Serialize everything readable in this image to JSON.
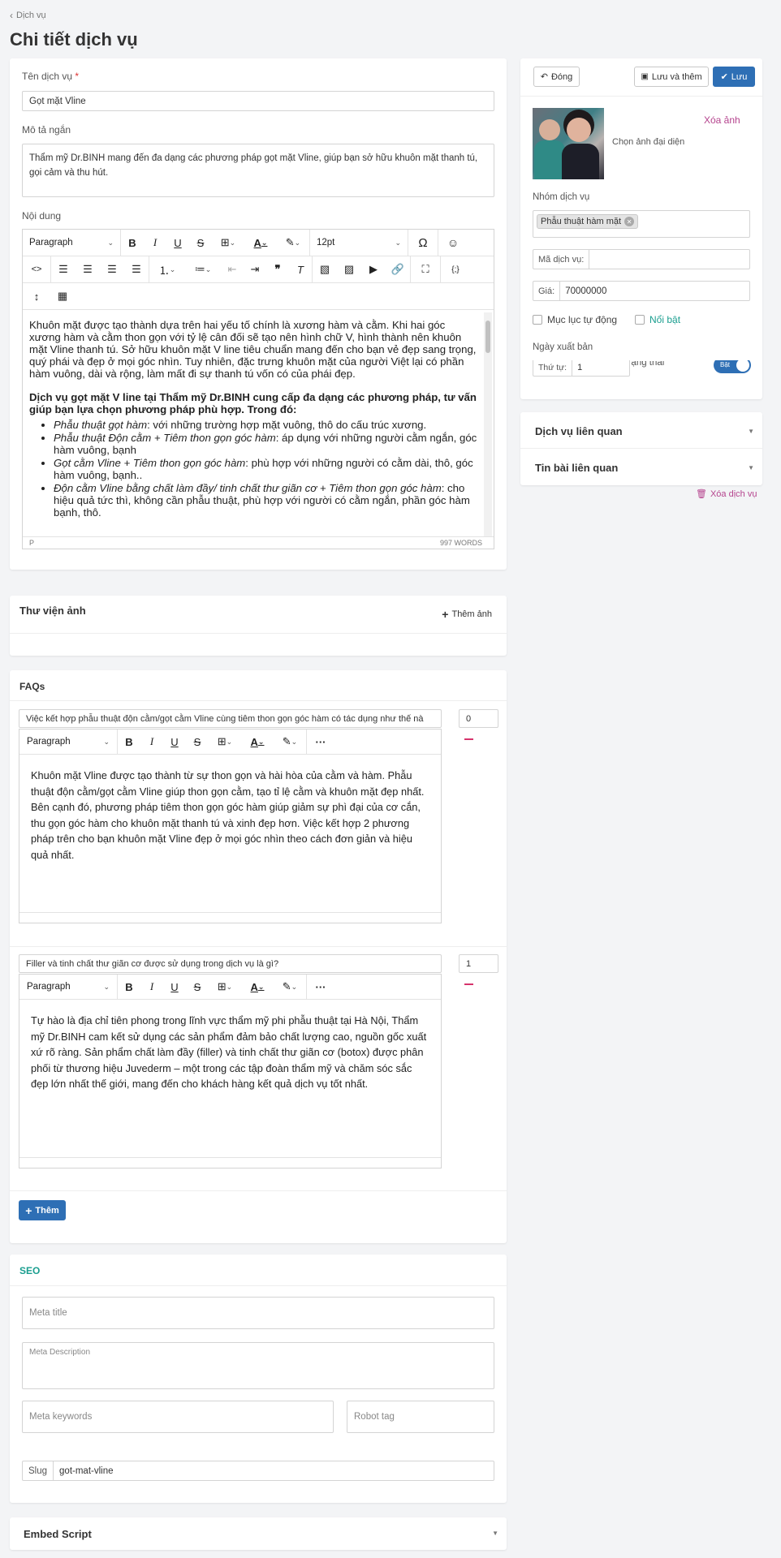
{
  "breadcrumb": "Dịch vụ",
  "page_title": "Chi tiết dịch vụ",
  "form": {
    "name_label": "Tên dịch vụ",
    "required_mark": "*",
    "name_value": "Gọt mặt Vline",
    "short_desc_label": "Mô tả ngắn",
    "short_desc_value": "Thẩm mỹ Dr.BINH mang đến đa dạng các phương pháp gọt mặt Vline, giúp bạn sở hữu khuôn mặt thanh tú, gọi cảm và thu hút.",
    "content_label": "Nội dung"
  },
  "editor": {
    "paragraph": "Paragraph",
    "font_size": "12pt",
    "para1": "Khuôn mặt được tạo thành dựa trên hai yếu tố chính là xương hàm và cằm. Khi hai góc xương hàm và cằm thon gọn với tỷ lệ cân đối sẽ tạo nên hình chữ V, hình thành nên khuôn mặt Vline thanh tú. Sở hữu khuôn mặt V line tiêu chuẩn mang đến cho bạn vẻ đẹp sang trọng, quý phái và đẹp ở mọi góc nhìn. Tuy nhiên, đặc trưng khuôn mặt của người Việt lại có phần hàm vuông, dài và rộng, làm mất đi sự thanh tú vốn có của phái đẹp.",
    "bold_para": "Dịch vụ gọt mặt V line tại Thẩm mỹ Dr.BINH cung cấp đa dạng các phương pháp, tư vấn giúp bạn lựa chọn phương pháp phù hợp. Trong đó:",
    "items": [
      {
        "em": "Phẫu thuật gọt hàm",
        "rest": ": với những trường hợp mặt vuông, thô do cấu trúc xương."
      },
      {
        "em": "Phẫu thuật Độn cằm + Tiêm thon gọn góc hàm",
        "rest": ": áp dụng với những người cằm ngắn, góc hàm vuông, bạnh"
      },
      {
        "em": "Gọt cằm Vline + Tiêm thon gọn góc hàm",
        "rest": ": phù hợp với những người có cằm dài, thô, góc hàm vuông, bạnh.."
      },
      {
        "em": "Độn cằm Vline bằng chất làm đầy/ tinh chất thư giãn cơ + Tiêm thon gọn góc hàm",
        "rest": ": cho hiệu quả tức thì, không cần phẫu thuật, phù hợp với người có cằm ngắn, phần góc hàm bạnh, thô."
      }
    ],
    "status_p": "P",
    "word_count": "997 WORDS"
  },
  "gallery": {
    "title": "Thư viện ảnh",
    "add": "Thêm ảnh"
  },
  "faqs": {
    "title": "FAQs",
    "items": [
      {
        "question": "Việc kết hợp phẫu thuật độn cằm/gọt cằm Vline cùng tiêm thon gọn góc hàm có tác dụng như thế nà",
        "order": "0",
        "answer": "Khuôn mặt Vline được tạo thành từ sự thon gọn và hài hòa của cằm và hàm. Phẫu thuật độn cằm/gọt cằm Vline giúp thon gọn cằm, tạo tỉ lệ cằm và khuôn mặt đẹp nhất. Bên cạnh đó, phương pháp tiêm thon gọn góc hàm giúp giảm sự phì đại của cơ cắn, thu gọn góc hàm cho khuôn mặt thanh tú và xinh đẹp hơn. Việc kết hợp 2 phương pháp trên cho bạn khuôn mặt Vline đẹp ở mọi góc nhìn theo cách đơn giản và hiệu quả nhất."
      },
      {
        "question": "Filler và tinh chất thư giãn cơ được sử dụng trong dịch vụ là gì?",
        "order": "1",
        "answer": "Tự hào là địa chỉ tiên phong trong lĩnh vực thẩm mỹ phi phẫu thuật tại Hà Nội, Thẩm mỹ Dr.BINH cam kết sử dụng các sản phẩm đảm bảo chất lượng cao, nguồn gốc xuất xứ rõ ràng. Sản phẩm chất làm đầy (filler) và tinh chất thư giãn cơ (botox) được phân phối từ thương hiệu Juvederm – một trong các tập đoàn thẩm mỹ và chăm sóc sắc đẹp lớn nhất thế giới, mang đến cho khách  hàng kết quả dịch vụ tốt nhất."
      }
    ],
    "add_button": "Thêm"
  },
  "seo": {
    "title": "SEO",
    "meta_title_ph": "Meta title",
    "meta_desc_ph": "Meta Description",
    "meta_keywords_ph": "Meta keywords",
    "robot_tag_ph": "Robot tag",
    "slug_label": "Slug",
    "slug_value": "got-mat-vline"
  },
  "embed": {
    "title": "Embed Script"
  },
  "sidebar": {
    "close_btn": "Đóng",
    "save_add_btn": "Lưu và thêm",
    "save_btn": "Lưu",
    "delete_image": "Xóa ảnh",
    "choose_avatar": "Chọn ảnh đại diện",
    "group_label": "Nhóm dịch vụ",
    "group_tag": "Phẫu thuật hàm mặt",
    "code_label": "Mã dịch vụ:",
    "price_label": "Giá:",
    "price_value": "70000000",
    "toc_label": "Mục lục tự động",
    "featured_label": "Nổi bật",
    "publish_label": "Ngày xuất bản",
    "order_label": "Thứ tự:",
    "order_value": "1",
    "status_label": "Trạng thái",
    "toggle_text": "Bật",
    "related_services": "Dịch vụ liên quan",
    "related_posts": "Tin bài liên quan",
    "delete_service": "Xóa dịch vụ"
  },
  "colors": {
    "primary": "#2e6fb5",
    "pink": "#b5448e",
    "teal": "#1a9e8f",
    "faq_minus": "#d6336c"
  }
}
